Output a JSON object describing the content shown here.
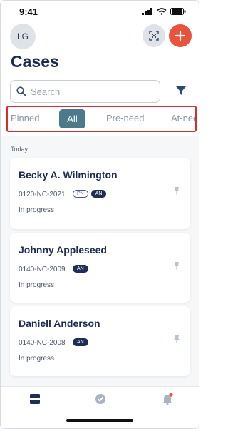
{
  "status_bar": {
    "time": "9:41",
    "icons": [
      "signal-icon",
      "wifi-icon",
      "battery-icon"
    ]
  },
  "header": {
    "avatar_initials": "LG",
    "title": "Cases",
    "scan_icon": "qr-scan-icon",
    "add_icon": "plus-icon",
    "filter_icon": "funnel-icon"
  },
  "search": {
    "placeholder": "Search",
    "value": ""
  },
  "tabs": [
    {
      "label": "Pinned",
      "selected": false
    },
    {
      "label": "All",
      "selected": true
    },
    {
      "label": "Pre-need",
      "selected": false
    },
    {
      "label": "At-need",
      "selected": false
    }
  ],
  "section": {
    "label": "Today"
  },
  "cases": [
    {
      "name": "Becky A. Wilmington",
      "code": "0120-NC-2021",
      "badges": [
        "PN",
        "AN"
      ],
      "status": "In progress"
    },
    {
      "name": "Johnny Appleseed",
      "code": "0140-NC-2009",
      "badges": [
        "AN"
      ],
      "status": "In progress"
    },
    {
      "name": "Daniell Anderson",
      "code": "0140-NC-2008",
      "badges": [
        "AN"
      ],
      "status": "In progress"
    }
  ],
  "bottom_nav": [
    {
      "icon": "cases-icon",
      "active": true
    },
    {
      "icon": "check-circle-icon",
      "active": false
    },
    {
      "icon": "bell-icon",
      "active": false,
      "has_notification": true
    }
  ],
  "colors": {
    "accent": "#e8533e",
    "selected_tab": "#4a7a8c",
    "title": "#1c2b4f",
    "highlight_border": "#d32f2f"
  }
}
